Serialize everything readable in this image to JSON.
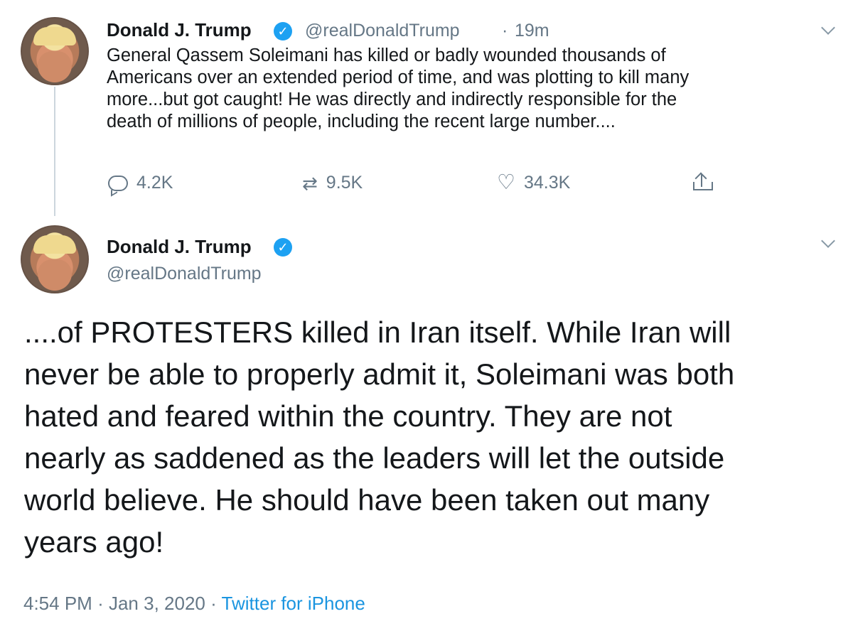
{
  "tweet1": {
    "name": "Donald J. Trump",
    "handle": "@realDonaldTrump",
    "separator": "·",
    "time": "19m",
    "text": "General Qassem Soleimani has killed or badly wounded thousands of\nAmericans over an extended period of time, and was plotting to kill many\nmore...but got caught! He was directly and indirectly responsible for the\ndeath of millions of people, including the recent large number....",
    "replies": "4.2K",
    "retweets": "9.5K",
    "likes": "34.3K"
  },
  "tweet2": {
    "name": "Donald J. Trump",
    "handle": "@realDonaldTrump",
    "text": "....of PROTESTERS killed in Iran itself. While Iran will\nnever be able to properly admit it, Soleimani was both\nhated and feared within the country. They are not\nnearly as saddened as the leaders will let the outside\nworld believe. He should have been taken out many\nyears ago!",
    "time": "4:54 PM",
    "date": "Jan 3, 2020",
    "separator": "·",
    "source": "Twitter for iPhone"
  },
  "icons": {
    "verified": "verified-badge-icon",
    "chevron": "chevron-down-icon",
    "reply": "reply-icon",
    "retweet": "retweet-icon",
    "like": "heart-icon",
    "share": "share-icon"
  },
  "colors": {
    "text": "#14171a",
    "muted": "#657786",
    "blue": "#1da1f2",
    "link": "#1b95e0",
    "thread_line": "#ccd6dd"
  }
}
